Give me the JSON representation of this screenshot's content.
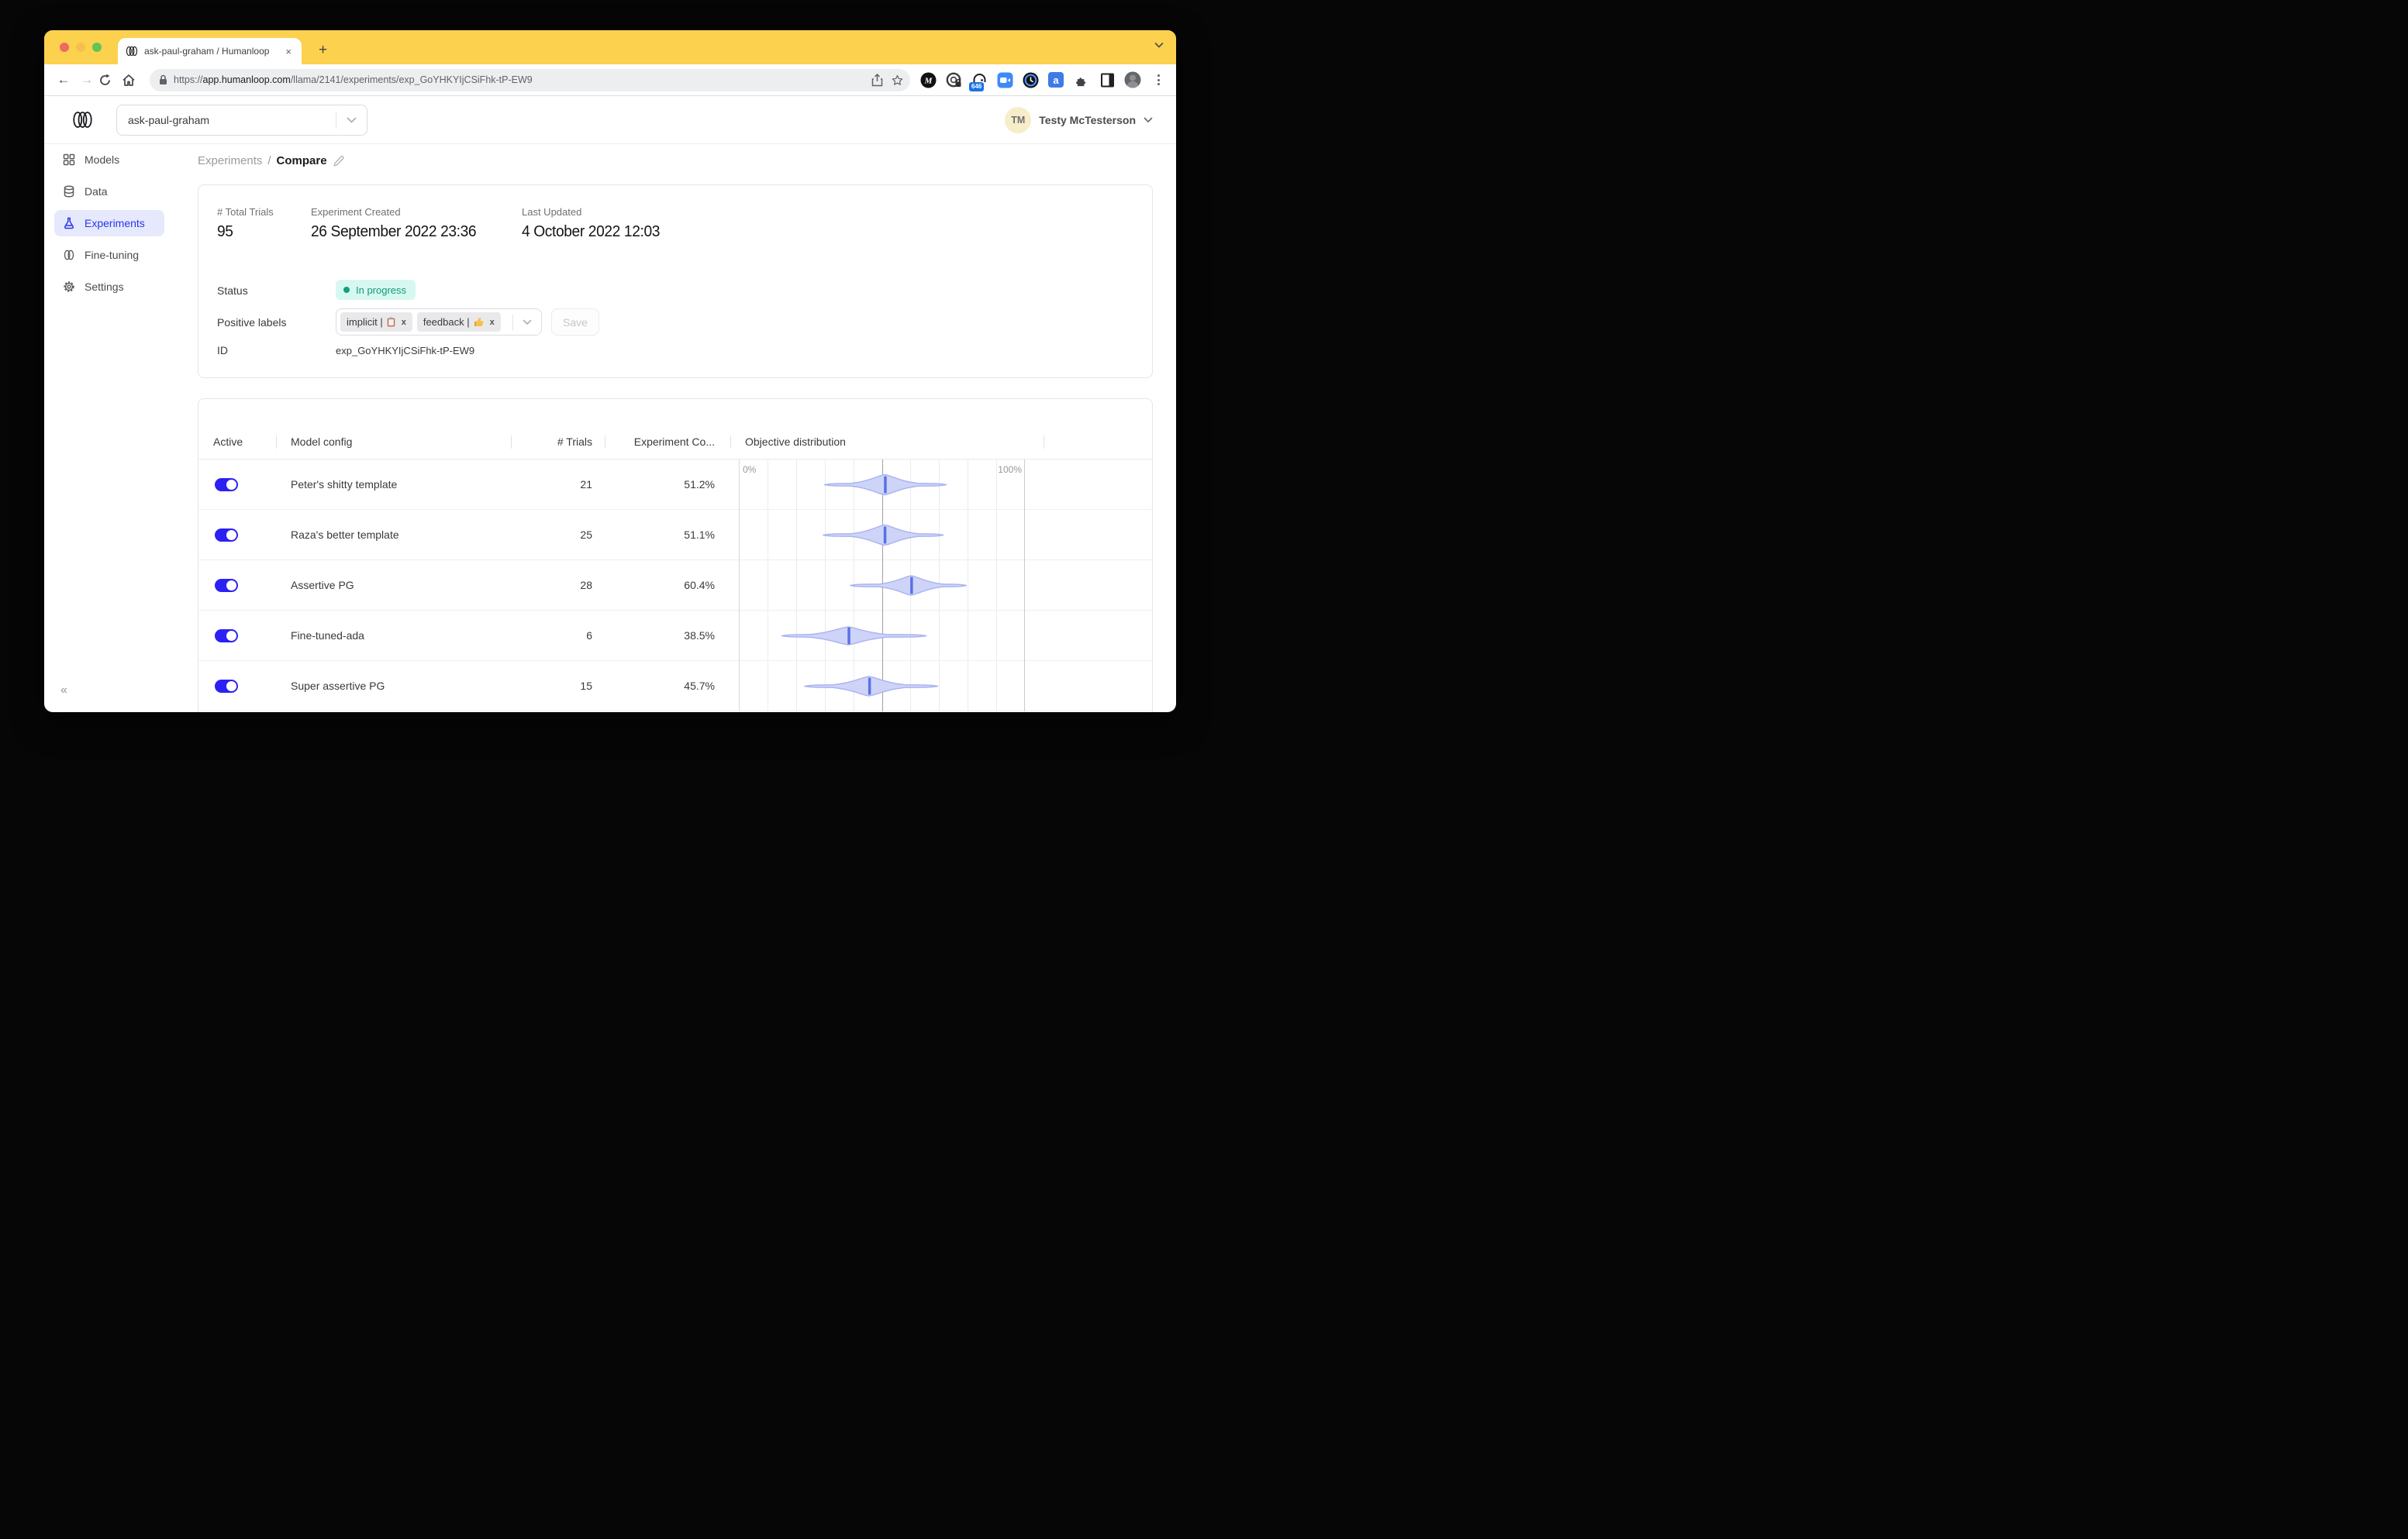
{
  "browser": {
    "tab": {
      "title": "ask-paul-graham / Humanloop",
      "close_glyph": "×",
      "new_tab_glyph": "+"
    },
    "toolbar": {
      "url_scheme": "https://",
      "url_host": "app.humanloop.com",
      "url_path": "/llama/2141/experiments/exp_GoYHKYIjCSiFhk-tP-EW9",
      "extension_badge": "646"
    }
  },
  "app": {
    "header": {
      "project_name": "ask-paul-graham",
      "user_initials": "TM",
      "user_name": "Testy McTesterson"
    },
    "sidebar": {
      "items": [
        {
          "label": "Models",
          "icon": "grid"
        },
        {
          "label": "Data",
          "icon": "database"
        },
        {
          "label": "Experiments",
          "icon": "flask",
          "active": true
        },
        {
          "label": "Fine-tuning",
          "icon": "loops"
        },
        {
          "label": "Settings",
          "icon": "gear"
        }
      ],
      "collapse_glyph": "«"
    },
    "breadcrumb": {
      "section": "Experiments",
      "separator": "/",
      "page": "Compare"
    },
    "details": {
      "total_trials_label": "# Total Trials",
      "total_trials": "95",
      "created_label": "Experiment Created",
      "created": "26 September 2022 23:36",
      "updated_label": "Last Updated",
      "updated": "4 October 2022 12:03",
      "status_label": "Status",
      "status": "In progress",
      "positive_labels_label": "Positive labels",
      "chips": [
        {
          "text": "implicit |",
          "icon": "clipboard-emoji",
          "remove_glyph": "x"
        },
        {
          "text": "feedback |",
          "icon": "thumbs-up-emoji",
          "remove_glyph": "x"
        }
      ],
      "save_label": "Save",
      "id_label": "ID",
      "id": "exp_GoYHKYIjCSiFhk-tP-EW9"
    },
    "table": {
      "columns": [
        "Active",
        "Model config",
        "# Trials",
        "Experiment Co...",
        "Objective distribution"
      ]
    }
  },
  "chart_data": {
    "type": "violin",
    "title": "Objective distribution",
    "axis": {
      "min": 0,
      "max": 100,
      "min_label": "0%",
      "max_label": "100%",
      "gridline_step_pct": 10,
      "reference_line_pct": 50
    },
    "rows": [
      {
        "model": "Peter's shitty template",
        "trials": "21",
        "score": "51.2%",
        "violin": {
          "min": 30,
          "max": 72.5,
          "peak": 51,
          "median": 51.2,
          "amp": 13
        }
      },
      {
        "model": "Raza's better template",
        "trials": "25",
        "score": "51.1%",
        "violin": {
          "min": 29.5,
          "max": 71.5,
          "peak": 51,
          "median": 51.1,
          "amp": 13
        }
      },
      {
        "model": "Assertive PG",
        "trials": "28",
        "score": "60.4%",
        "violin": {
          "min": 39,
          "max": 79.5,
          "peak": 60.2,
          "median": 60.4,
          "amp": 12.5
        }
      },
      {
        "model": "Fine-tuned-ada",
        "trials": "6",
        "score": "38.5%",
        "violin": {
          "min": 15,
          "max": 65.5,
          "peak": 38.2,
          "median": 38.5,
          "amp": 11.5
        }
      },
      {
        "model": "Super assertive PG",
        "trials": "15",
        "score": "45.7%",
        "violin": {
          "min": 23,
          "max": 69.5,
          "peak": 45.5,
          "median": 45.7,
          "amp": 12.5
        }
      }
    ],
    "colors": {
      "violin_fill": "#CDD4F8",
      "violin_stroke": "#A9B3EF",
      "median": "#5A71E4",
      "grid": "#ECECEF",
      "grid_left": "#D8D8DB",
      "grid_right": "#C9CACE",
      "reference": "#9FA0A6"
    }
  },
  "colors": {
    "tab_strip": "#FBD14E",
    "accent_blue": "#2B21F2",
    "sidebar_active_bg": "#E6E9FC",
    "sidebar_active_text": "#2636EA",
    "status_bg": "#D7F8F0",
    "status_text": "#129B74"
  }
}
